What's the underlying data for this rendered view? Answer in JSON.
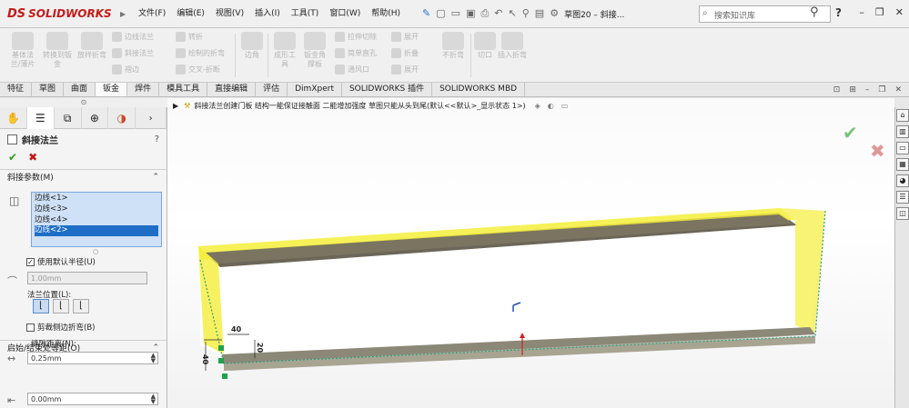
{
  "app": {
    "brand": "SOLIDWORKS",
    "logo_mark": "DS",
    "menu": [
      "文件(F)",
      "编辑(E)",
      "视图(V)",
      "插入(I)",
      "工具(T)",
      "窗口(W)",
      "帮助(H)"
    ],
    "doc_title": "草图20 – 斜接...",
    "search_placeholder": "搜索知识库",
    "help_label": "?"
  },
  "ribbon": {
    "big_buttons": [
      "基体法兰/薄片",
      "转换到钣金",
      "放样折弯",
      "边角",
      "成形工具",
      "钣金角撑板",
      "不折弯",
      "切口",
      "插入折弯"
    ],
    "small_buttons": [
      "边线法兰",
      "斜接法兰",
      "褶边",
      "转折",
      "绘制的折弯",
      "交叉-折断",
      "拉伸切除",
      "简单直孔",
      "通风口",
      "展开",
      "折叠",
      "展开"
    ]
  },
  "tabs": {
    "items": [
      "特征",
      "草图",
      "曲面",
      "钣金",
      "焊件",
      "模具工具",
      "直接编辑",
      "评估",
      "DimXpert",
      "SOLIDWORKS 插件",
      "SOLIDWORKS MBD"
    ],
    "active_index": 3
  },
  "property_manager": {
    "title": "斜接法兰",
    "section_miter_params": "斜接参数(M)",
    "edges": [
      "边线<1>",
      "边线<3>",
      "边线<4>",
      "边线<2>"
    ],
    "selected_edge_index": 3,
    "use_default_radius": "使用默认半径(U)",
    "radius_value": "1.00mm",
    "flange_position_label": "法兰位置(L):",
    "trim_side_bends": "剪裁侧边折弯(B)",
    "gap_distance_label": "缝隙距离(N):",
    "gap_value": "0.25mm",
    "section_offset": "启始/结束处等距(O)",
    "offset_value": "0.00mm"
  },
  "viewport": {
    "breadcrumb": "斜接法兰创建门板 结构一能保证接触面 二能增加强度 草图只能从头到尾(默认<<默认>_显示状态 1>)",
    "dimensions": [
      "40",
      "20",
      "40"
    ]
  },
  "colors": {
    "accent_yellow": "#f5ee3a",
    "selected_blue": "#1e6ec8",
    "ok_green": "#2f9a1c",
    "cancel_red": "#c01818"
  }
}
